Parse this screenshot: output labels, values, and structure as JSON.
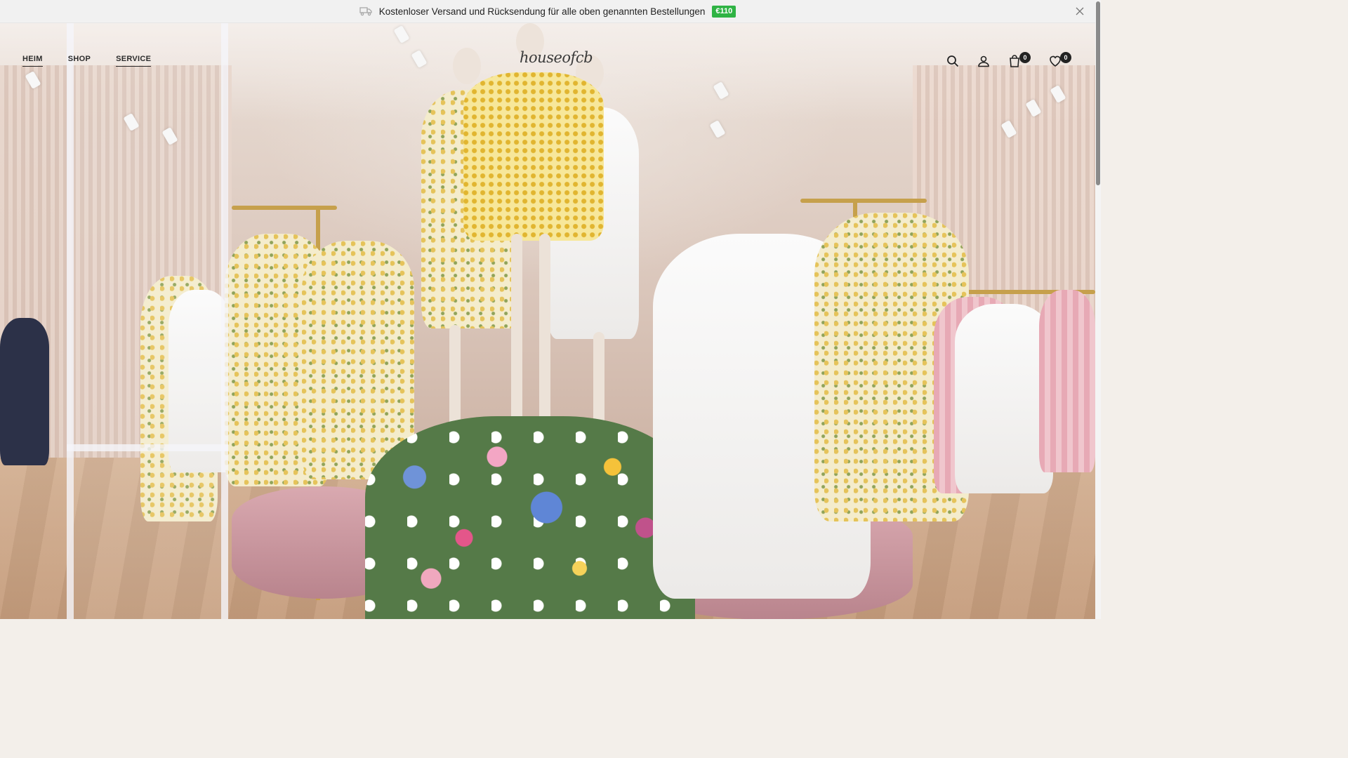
{
  "announcement": {
    "text": "Kostenloser Versand und Rücksendung für alle oben genannten Bestellungen",
    "badge": "€110"
  },
  "header": {
    "logo": "houseofcb",
    "nav": [
      {
        "label": "HEIM"
      },
      {
        "label": "SHOP"
      },
      {
        "label": "SERVICE"
      }
    ],
    "cart_count": "0",
    "wishlist_count": "0"
  },
  "icons": {
    "truck": "truck-icon",
    "close": "close-icon",
    "search": "search-icon",
    "account": "user-icon",
    "cart": "shopping-bag-icon",
    "wishlist": "heart-icon"
  },
  "colors": {
    "badge_bg": "#2fb344",
    "text": "#222222",
    "announcement_bg": "#f1f1f1"
  }
}
